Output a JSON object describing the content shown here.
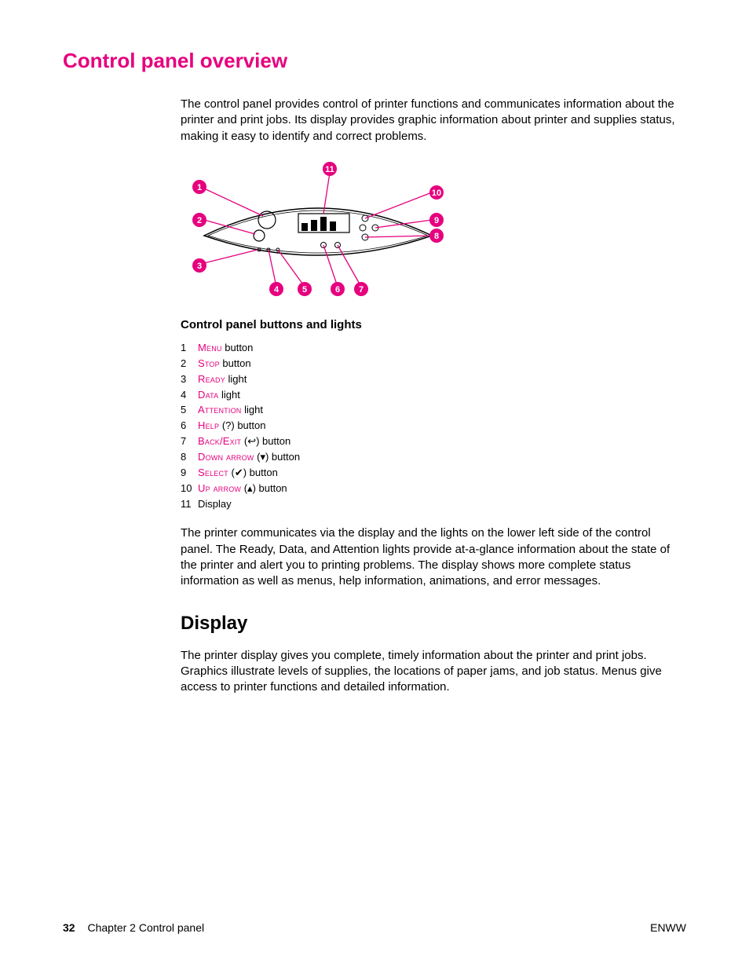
{
  "title": "Control panel overview",
  "intro": "The control panel provides control of printer functions and communicates information about the printer and print jobs. Its display provides graphic information about printer and supplies status, making it easy to identify and correct problems.",
  "figure_caption": "Control panel buttons and lights",
  "callouts": [
    "1",
    "2",
    "3",
    "4",
    "5",
    "6",
    "7",
    "8",
    "9",
    "10",
    "11"
  ],
  "legend": [
    {
      "n": "1",
      "sc": "Menu",
      "rest": " button"
    },
    {
      "n": "2",
      "sc": "Stop",
      "rest": " button"
    },
    {
      "n": "3",
      "sc": "Ready",
      "rest": " light"
    },
    {
      "n": "4",
      "sc": "Data",
      "rest": " light"
    },
    {
      "n": "5",
      "sc": "Attention",
      "rest": " light"
    },
    {
      "n": "6",
      "sc": "Help",
      "sym": " (?)",
      "rest": " button"
    },
    {
      "n": "7",
      "sc": "Back/Exit",
      "sym": " (↩)",
      "rest": " button"
    },
    {
      "n": "8",
      "sc": "Down arrow",
      "sym": " (▾)",
      "rest": " button"
    },
    {
      "n": "9",
      "sc": "Select",
      "sym": " (✔)",
      "rest": " button"
    },
    {
      "n": "10",
      "sc": "Up arrow",
      "sym": " (▴)",
      "rest": " button"
    },
    {
      "n": "11",
      "plain": "Display"
    }
  ],
  "para2": "The printer communicates via the display and the lights on the lower left side of the control panel. The Ready, Data, and Attention lights provide at-a-glance information about the state of the printer and alert you to printing problems. The display shows more complete status information as well as menus, help information, animations, and error messages.",
  "display_heading": "Display",
  "display_para": "The printer display gives you complete, timely information about the printer and print jobs. Graphics illustrate levels of supplies, the locations of paper jams, and job status. Menus give access to printer functions and detailed information.",
  "footer": {
    "page": "32",
    "chapter": "Chapter 2   Control panel",
    "right": "ENWW"
  }
}
